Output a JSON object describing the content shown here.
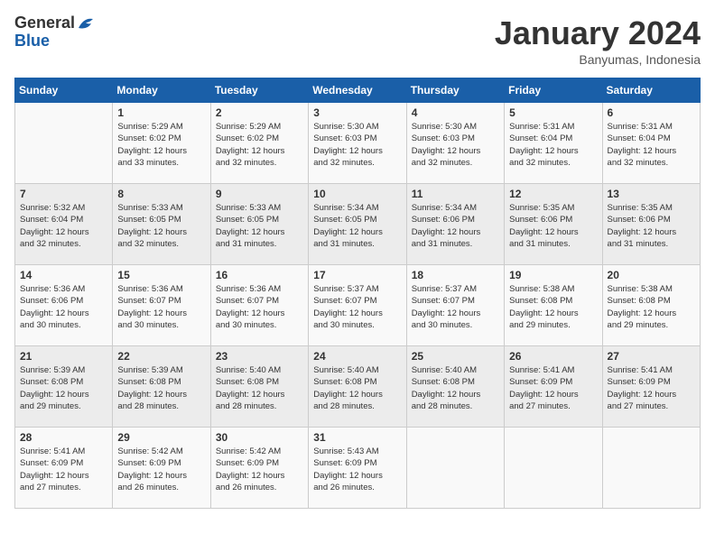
{
  "header": {
    "logo_line1": "General",
    "logo_line2": "Blue",
    "month": "January 2024",
    "location": "Banyumas, Indonesia"
  },
  "weekdays": [
    "Sunday",
    "Monday",
    "Tuesday",
    "Wednesday",
    "Thursday",
    "Friday",
    "Saturday"
  ],
  "weeks": [
    [
      {
        "day": "",
        "info": ""
      },
      {
        "day": "1",
        "info": "Sunrise: 5:29 AM\nSunset: 6:02 PM\nDaylight: 12 hours\nand 33 minutes."
      },
      {
        "day": "2",
        "info": "Sunrise: 5:29 AM\nSunset: 6:02 PM\nDaylight: 12 hours\nand 32 minutes."
      },
      {
        "day": "3",
        "info": "Sunrise: 5:30 AM\nSunset: 6:03 PM\nDaylight: 12 hours\nand 32 minutes."
      },
      {
        "day": "4",
        "info": "Sunrise: 5:30 AM\nSunset: 6:03 PM\nDaylight: 12 hours\nand 32 minutes."
      },
      {
        "day": "5",
        "info": "Sunrise: 5:31 AM\nSunset: 6:04 PM\nDaylight: 12 hours\nand 32 minutes."
      },
      {
        "day": "6",
        "info": "Sunrise: 5:31 AM\nSunset: 6:04 PM\nDaylight: 12 hours\nand 32 minutes."
      }
    ],
    [
      {
        "day": "7",
        "info": "Sunrise: 5:32 AM\nSunset: 6:04 PM\nDaylight: 12 hours\nand 32 minutes."
      },
      {
        "day": "8",
        "info": "Sunrise: 5:33 AM\nSunset: 6:05 PM\nDaylight: 12 hours\nand 32 minutes."
      },
      {
        "day": "9",
        "info": "Sunrise: 5:33 AM\nSunset: 6:05 PM\nDaylight: 12 hours\nand 31 minutes."
      },
      {
        "day": "10",
        "info": "Sunrise: 5:34 AM\nSunset: 6:05 PM\nDaylight: 12 hours\nand 31 minutes."
      },
      {
        "day": "11",
        "info": "Sunrise: 5:34 AM\nSunset: 6:06 PM\nDaylight: 12 hours\nand 31 minutes."
      },
      {
        "day": "12",
        "info": "Sunrise: 5:35 AM\nSunset: 6:06 PM\nDaylight: 12 hours\nand 31 minutes."
      },
      {
        "day": "13",
        "info": "Sunrise: 5:35 AM\nSunset: 6:06 PM\nDaylight: 12 hours\nand 31 minutes."
      }
    ],
    [
      {
        "day": "14",
        "info": "Sunrise: 5:36 AM\nSunset: 6:06 PM\nDaylight: 12 hours\nand 30 minutes."
      },
      {
        "day": "15",
        "info": "Sunrise: 5:36 AM\nSunset: 6:07 PM\nDaylight: 12 hours\nand 30 minutes."
      },
      {
        "day": "16",
        "info": "Sunrise: 5:36 AM\nSunset: 6:07 PM\nDaylight: 12 hours\nand 30 minutes."
      },
      {
        "day": "17",
        "info": "Sunrise: 5:37 AM\nSunset: 6:07 PM\nDaylight: 12 hours\nand 30 minutes."
      },
      {
        "day": "18",
        "info": "Sunrise: 5:37 AM\nSunset: 6:07 PM\nDaylight: 12 hours\nand 30 minutes."
      },
      {
        "day": "19",
        "info": "Sunrise: 5:38 AM\nSunset: 6:08 PM\nDaylight: 12 hours\nand 29 minutes."
      },
      {
        "day": "20",
        "info": "Sunrise: 5:38 AM\nSunset: 6:08 PM\nDaylight: 12 hours\nand 29 minutes."
      }
    ],
    [
      {
        "day": "21",
        "info": "Sunrise: 5:39 AM\nSunset: 6:08 PM\nDaylight: 12 hours\nand 29 minutes."
      },
      {
        "day": "22",
        "info": "Sunrise: 5:39 AM\nSunset: 6:08 PM\nDaylight: 12 hours\nand 28 minutes."
      },
      {
        "day": "23",
        "info": "Sunrise: 5:40 AM\nSunset: 6:08 PM\nDaylight: 12 hours\nand 28 minutes."
      },
      {
        "day": "24",
        "info": "Sunrise: 5:40 AM\nSunset: 6:08 PM\nDaylight: 12 hours\nand 28 minutes."
      },
      {
        "day": "25",
        "info": "Sunrise: 5:40 AM\nSunset: 6:08 PM\nDaylight: 12 hours\nand 28 minutes."
      },
      {
        "day": "26",
        "info": "Sunrise: 5:41 AM\nSunset: 6:09 PM\nDaylight: 12 hours\nand 27 minutes."
      },
      {
        "day": "27",
        "info": "Sunrise: 5:41 AM\nSunset: 6:09 PM\nDaylight: 12 hours\nand 27 minutes."
      }
    ],
    [
      {
        "day": "28",
        "info": "Sunrise: 5:41 AM\nSunset: 6:09 PM\nDaylight: 12 hours\nand 27 minutes."
      },
      {
        "day": "29",
        "info": "Sunrise: 5:42 AM\nSunset: 6:09 PM\nDaylight: 12 hours\nand 26 minutes."
      },
      {
        "day": "30",
        "info": "Sunrise: 5:42 AM\nSunset: 6:09 PM\nDaylight: 12 hours\nand 26 minutes."
      },
      {
        "day": "31",
        "info": "Sunrise: 5:43 AM\nSunset: 6:09 PM\nDaylight: 12 hours\nand 26 minutes."
      },
      {
        "day": "",
        "info": ""
      },
      {
        "day": "",
        "info": ""
      },
      {
        "day": "",
        "info": ""
      }
    ]
  ]
}
